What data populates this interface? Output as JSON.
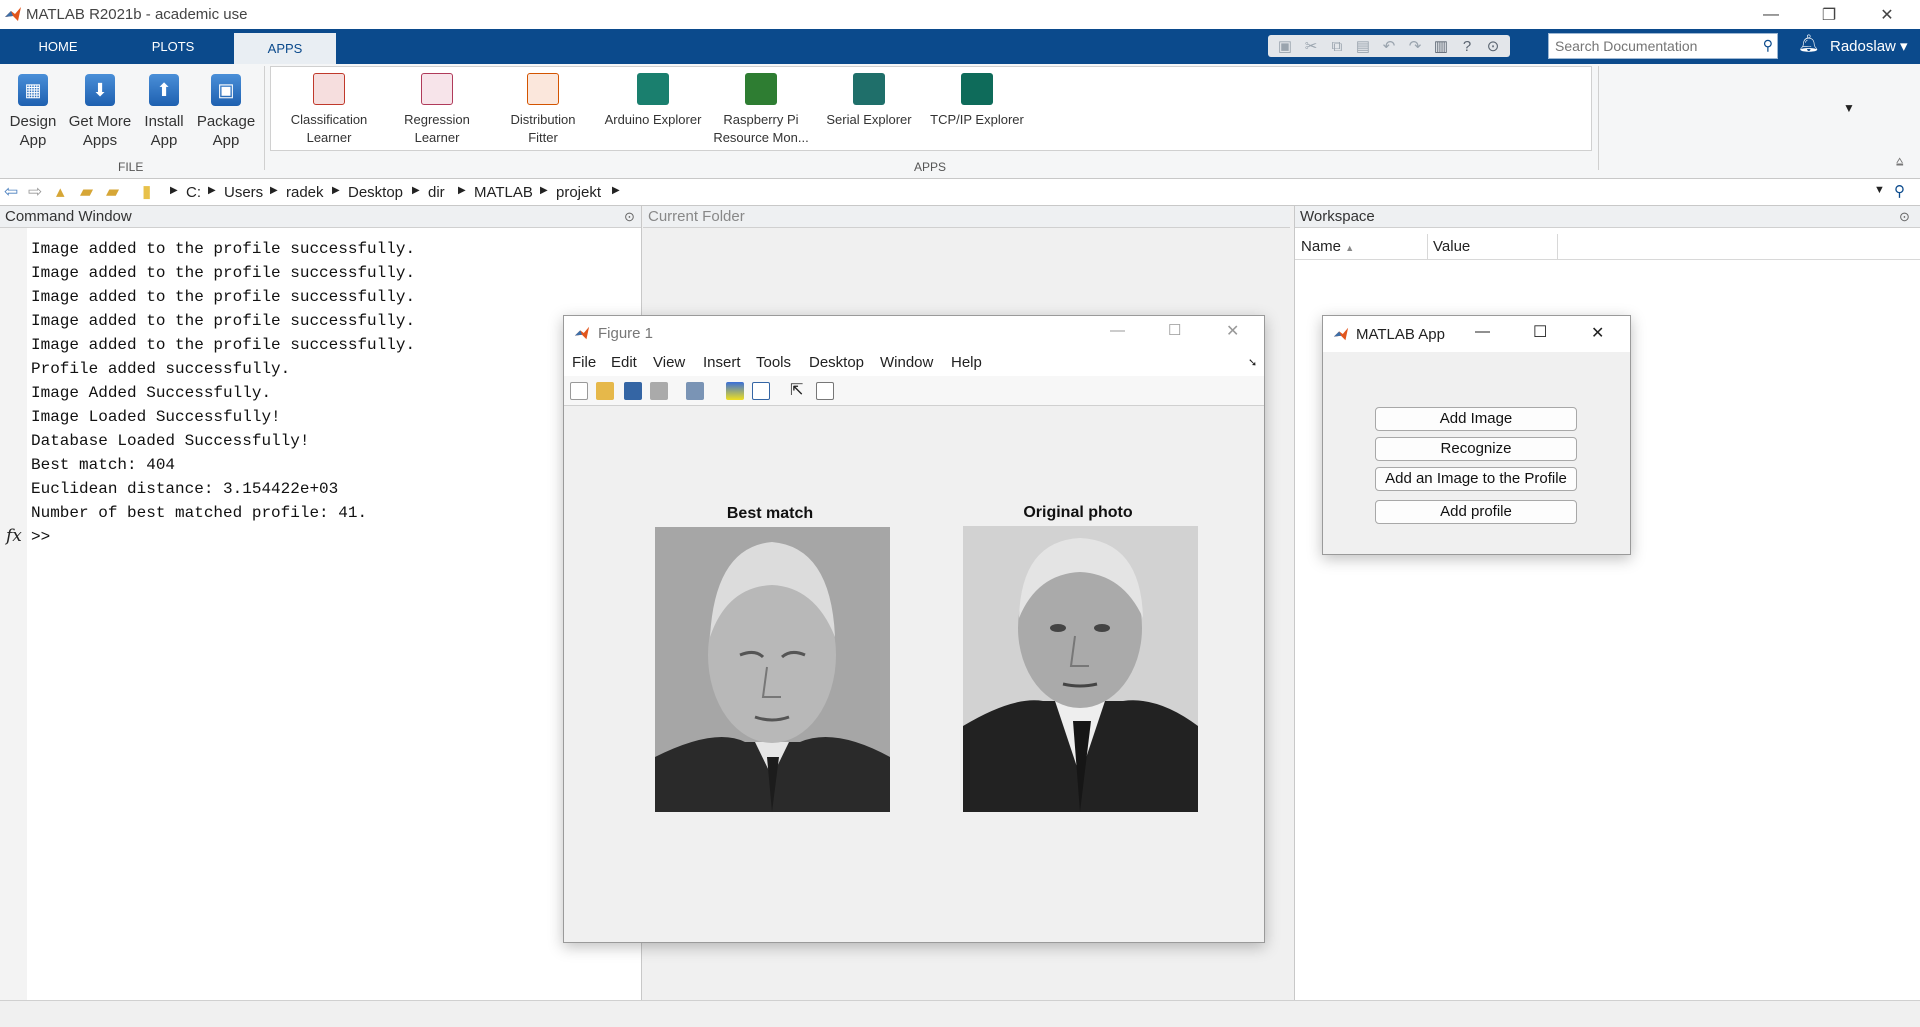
{
  "window": {
    "title": "MATLAB R2021b - academic use"
  },
  "tabs": [
    {
      "label": "HOME"
    },
    {
      "label": "PLOTS"
    },
    {
      "label": "APPS"
    }
  ],
  "search": {
    "placeholder": "Search Documentation"
  },
  "user": {
    "name": "Radoslaw"
  },
  "ribbon": {
    "file_section": {
      "label": "FILE",
      "buttons": [
        {
          "line1": "Design",
          "line2": "App"
        },
        {
          "line1": "Get More",
          "line2": "Apps"
        },
        {
          "line1": "Install",
          "line2": "App"
        },
        {
          "line1": "Package",
          "line2": "App"
        }
      ]
    },
    "apps_section": {
      "label": "APPS",
      "apps": [
        {
          "line1": "Classification",
          "line2": "Learner",
          "color": "#c0392b"
        },
        {
          "line1": "Regression",
          "line2": "Learner",
          "color": "#b03a5a"
        },
        {
          "line1": "Distribution",
          "line2": "Fitter",
          "color": "#d35400"
        },
        {
          "line1": "Arduino Explorer",
          "line2": "",
          "color": "#1a7f6e"
        },
        {
          "line1": "Raspberry Pi",
          "line2": "Resource Mon...",
          "color": "#2e7d32"
        },
        {
          "line1": "Serial Explorer",
          "line2": "",
          "color": "#1f6f6a"
        },
        {
          "line1": "TCP/IP Explorer",
          "line2": "",
          "color": "#0e6b5a"
        }
      ]
    }
  },
  "path": {
    "crumbs": [
      "C:",
      "Users",
      "radek",
      "Desktop",
      "dir",
      "MATLAB",
      "projekt"
    ]
  },
  "panels": {
    "command_window": "Command Window",
    "current_folder": "Current Folder",
    "workspace": "Workspace"
  },
  "workspace": {
    "columns": [
      "Name",
      "Value"
    ]
  },
  "command_window": {
    "lines": [
      "Image added to the profile successfully.",
      "Image added to the profile successfully.",
      "Image added to the profile successfully.",
      "Image added to the profile successfully.",
      "Image added to the profile successfully.",
      "Profile added successfully.",
      "Image Added Successfully.",
      "Image Loaded Successfully!",
      "Database Loaded Successfully!",
      "Best match: 404",
      "Euclidean distance: 3.154422e+03",
      "Number of best matched profile: 41."
    ],
    "fx": "fx",
    "prompt": ">>"
  },
  "figure": {
    "title": "Figure 1",
    "menu": [
      "File",
      "Edit",
      "View",
      "Insert",
      "Tools",
      "Desktop",
      "Window",
      "Help"
    ],
    "axes": [
      {
        "title": "Best match"
      },
      {
        "title": "Original photo"
      }
    ]
  },
  "app_window": {
    "title": "MATLAB App",
    "buttons": [
      "Add Image",
      "Recognize",
      "Add an Image to the Profile",
      "Add profile"
    ]
  },
  "colors": {
    "tabstrip": "#0b4a8c",
    "accent": "#4a8fd8"
  }
}
